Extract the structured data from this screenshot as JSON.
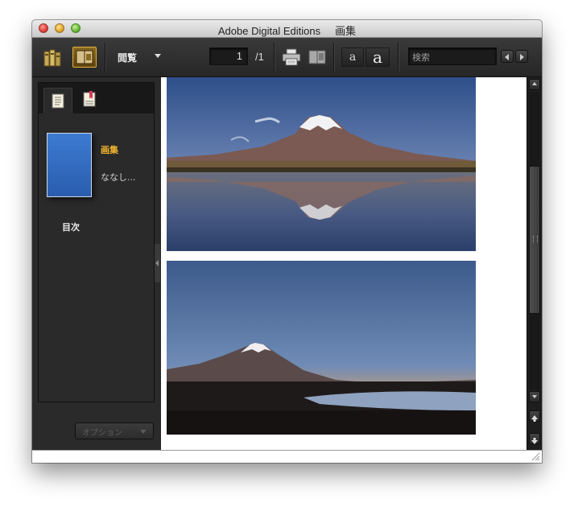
{
  "window": {
    "title": "Adobe Digital Editions",
    "subtitle": "画集"
  },
  "toolbar": {
    "library_icon": "library-books-icon",
    "reading_icon": "reading-view-icon",
    "view_label": "閲覧",
    "page_current": "1",
    "page_total": "/1",
    "print_icon": "printer-icon",
    "book_icon": "book-icon",
    "font_decrease": "a",
    "font_increase": "a",
    "search_placeholder": "検索",
    "accent_color": "#e2b23d"
  },
  "sidebar": {
    "tabs": [
      {
        "name": "toc-tab",
        "icon": "toc-list-icon",
        "active": true
      },
      {
        "name": "bookmarks-tab",
        "icon": "bookmark-icon",
        "active": false
      }
    ],
    "book": {
      "title": "画集",
      "author": "ななし..."
    },
    "toc_label": "目次",
    "options_label": "オプション"
  },
  "content": {
    "images": [
      {
        "name": "mount-fuji-lake-reflection-photo",
        "icon": "photo-icon"
      },
      {
        "name": "mount-fuji-dusk-photo",
        "icon": "photo-icon"
      }
    ]
  },
  "scrollbar": {
    "up_icon": "arrow-up-icon",
    "down_icon": "arrow-down-icon",
    "prev_page_icon": "page-up-icon",
    "next_page_icon": "page-down-icon"
  }
}
